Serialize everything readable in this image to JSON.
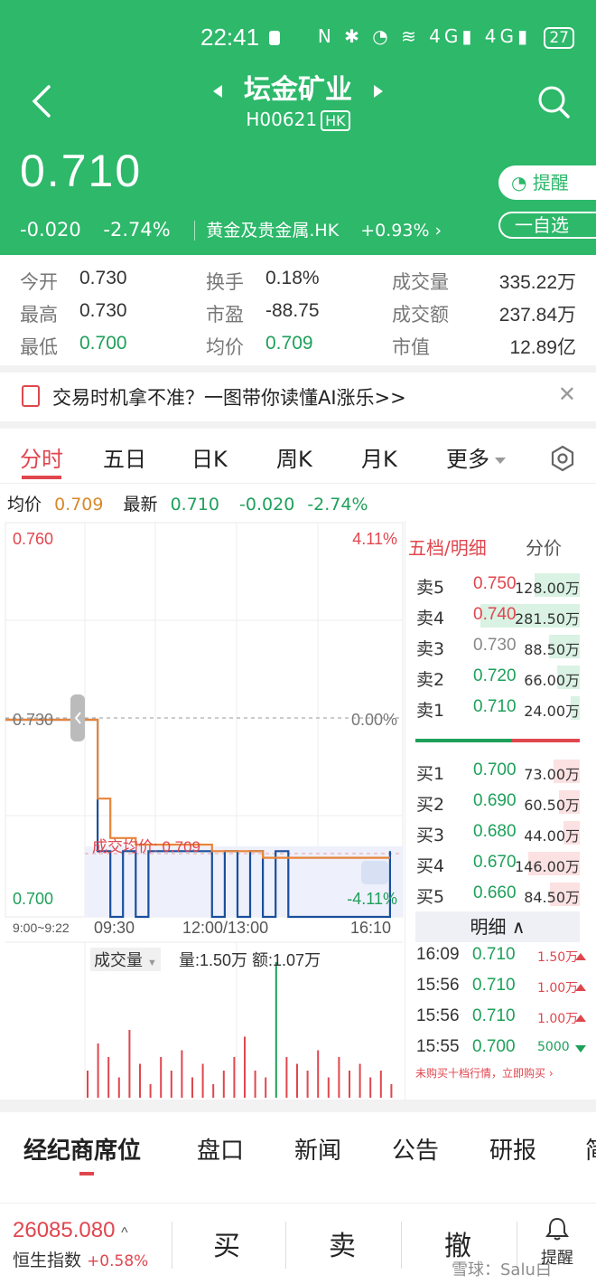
{
  "status_bar": {
    "time": "22:41",
    "icons": "N ✱ ◔ ≋ 4G▮ 4G▮",
    "battery": "27"
  },
  "header": {
    "stock_name": "坛金矿业",
    "stock_code": "H00621",
    "market_badge": "HK",
    "price": "0.710",
    "change": "-0.020",
    "change_pct": "-2.74%",
    "sector": "黄金及贵金属.HK",
    "sector_change": "+0.93% ›",
    "remind_label": "提醒",
    "watch_label": "一自选"
  },
  "stats": [
    {
      "label": "今开",
      "value": "0.730"
    },
    {
      "label": "最高",
      "value": "0.730"
    },
    {
      "label": "最低",
      "value": "0.700"
    },
    {
      "label": "换手",
      "value": "0.18%"
    },
    {
      "label": "市盈",
      "value": "-88.75"
    },
    {
      "label": "均价",
      "value": "0.709"
    },
    {
      "label": "成交量",
      "value": "335.22万"
    },
    {
      "label": "成交额",
      "value": "237.84万"
    },
    {
      "label": "市值",
      "value": "12.89亿"
    }
  ],
  "promo": {
    "text": "交易时机拿不准？一图带你读懂AI涨乐>>",
    "close": "✕"
  },
  "tabs": [
    "分时",
    "五日",
    "日K",
    "周K",
    "月K",
    "更多"
  ],
  "avg_row": {
    "avg_label": "均价",
    "avg_value": "0.709",
    "latest_label": "最新",
    "latest_value": "0.710",
    "change": "-0.020",
    "change_pct": "-2.74%"
  },
  "chart": {
    "price_high": "0.760",
    "pct_high": "4.11%",
    "price_mid": "0.730",
    "pct_mid": "0.00%",
    "price_low": "0.700",
    "pct_low": "-4.11%",
    "avg_line_label": "成交均价: 0.709",
    "time_labels": [
      "9:00~9:22",
      "09:30",
      "12:00/13:00",
      "16:10"
    ],
    "volume_label": "成交量",
    "volume_stats": "量:1.50万  额:1.07万"
  },
  "chart_data": {
    "type": "line",
    "title": "分时",
    "ylim": [
      0.7,
      0.76
    ],
    "y_ticks": [
      0.7,
      0.73,
      0.76
    ],
    "y_pct_ticks": [
      "-4.11%",
      "0.00%",
      "4.11%"
    ],
    "x_ticks": [
      "9:00~9:22",
      "09:30",
      "12:00/13:00",
      "16:10"
    ],
    "prev_close": 0.73,
    "avg_price": 0.709,
    "series": [
      {
        "name": "最新",
        "values": [
          0.73,
          0.73,
          0.73,
          0.71,
          0.7,
          0.71,
          0.7,
          0.71,
          0.71,
          0.71,
          0.71,
          0.71,
          0.7,
          0.71,
          0.7,
          0.71,
          0.7,
          0.71,
          0.7,
          0.7,
          0.7,
          0.7,
          0.7,
          0.7,
          0.7,
          0.7,
          0.71
        ]
      },
      {
        "name": "均价",
        "values": [
          0.73,
          0.73,
          0.73,
          0.718,
          0.712,
          0.712,
          0.711,
          0.711,
          0.711,
          0.711,
          0.711,
          0.711,
          0.71,
          0.71,
          0.71,
          0.71,
          0.709,
          0.709,
          0.709,
          0.709,
          0.709,
          0.709,
          0.709,
          0.709,
          0.709,
          0.709,
          0.709
        ]
      }
    ]
  },
  "orderbook": {
    "head_label": "五档/明细",
    "head_alt": "分价",
    "asks": [
      {
        "label": "卖5",
        "price": "0.750",
        "volume": "128.00万",
        "level": 0.45
      },
      {
        "label": "卖4",
        "price": "0.740",
        "volume": "281.50万",
        "level": 1.0
      },
      {
        "label": "卖3",
        "price": "0.730",
        "volume": "88.50万",
        "level": 0.31
      },
      {
        "label": "卖2",
        "price": "0.720",
        "volume": "66.00万",
        "level": 0.23
      },
      {
        "label": "卖1",
        "price": "0.710",
        "volume": "24.00万",
        "level": 0.09
      }
    ],
    "bids": [
      {
        "label": "买1",
        "price": "0.700",
        "volume": "73.00万",
        "level": 0.26
      },
      {
        "label": "买2",
        "price": "0.690",
        "volume": "60.50万",
        "level": 0.21
      },
      {
        "label": "买3",
        "price": "0.680",
        "volume": "44.00万",
        "level": 0.16
      },
      {
        "label": "买4",
        "price": "0.670",
        "volume": "146.00万",
        "level": 0.52
      },
      {
        "label": "买5",
        "price": "0.660",
        "volume": "84.50万",
        "level": 0.3
      }
    ],
    "detail_label": "明细 ∧",
    "ticks": [
      {
        "time": "16:09",
        "price": "0.710",
        "volume": "1.50万",
        "dir": "up"
      },
      {
        "time": "15:56",
        "price": "0.710",
        "volume": "1.00万",
        "dir": "up"
      },
      {
        "time": "15:56",
        "price": "0.710",
        "volume": "1.00万",
        "dir": "up"
      },
      {
        "time": "15:55",
        "price": "0.700",
        "volume": "5000",
        "dir": "down"
      }
    ],
    "upsell": "未购买十档行情，立即购买  ›"
  },
  "bottom_tabs": [
    "经纪商席位",
    "盘口",
    "新闻",
    "公告",
    "研报",
    "简"
  ],
  "index": {
    "value": "26085.080",
    "name": "恒生指数",
    "change": "+0.58%"
  },
  "actions": {
    "buy": "买",
    "sell": "卖",
    "cancel": "撤",
    "remind": "提醒"
  },
  "watermark": "雪球：Salu白",
  "colors": {
    "brand_green": "#2db86a",
    "up_red": "#e0464e",
    "down_green": "#1ea05a",
    "avg_orange": "#e8843a",
    "price_blue": "#1a4f9c"
  }
}
